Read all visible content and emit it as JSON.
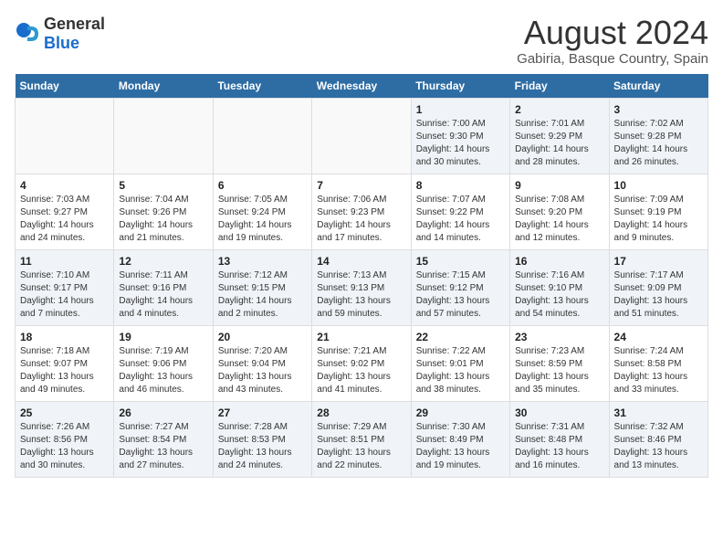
{
  "logo": {
    "general": "General",
    "blue": "Blue"
  },
  "title": "August 2024",
  "subtitle": "Gabiria, Basque Country, Spain",
  "days_of_week": [
    "Sunday",
    "Monday",
    "Tuesday",
    "Wednesday",
    "Thursday",
    "Friday",
    "Saturday"
  ],
  "weeks": [
    [
      {
        "day": "",
        "info": ""
      },
      {
        "day": "",
        "info": ""
      },
      {
        "day": "",
        "info": ""
      },
      {
        "day": "",
        "info": ""
      },
      {
        "day": "1",
        "info": "Sunrise: 7:00 AM\nSunset: 9:30 PM\nDaylight: 14 hours\nand 30 minutes."
      },
      {
        "day": "2",
        "info": "Sunrise: 7:01 AM\nSunset: 9:29 PM\nDaylight: 14 hours\nand 28 minutes."
      },
      {
        "day": "3",
        "info": "Sunrise: 7:02 AM\nSunset: 9:28 PM\nDaylight: 14 hours\nand 26 minutes."
      }
    ],
    [
      {
        "day": "4",
        "info": "Sunrise: 7:03 AM\nSunset: 9:27 PM\nDaylight: 14 hours\nand 24 minutes."
      },
      {
        "day": "5",
        "info": "Sunrise: 7:04 AM\nSunset: 9:26 PM\nDaylight: 14 hours\nand 21 minutes."
      },
      {
        "day": "6",
        "info": "Sunrise: 7:05 AM\nSunset: 9:24 PM\nDaylight: 14 hours\nand 19 minutes."
      },
      {
        "day": "7",
        "info": "Sunrise: 7:06 AM\nSunset: 9:23 PM\nDaylight: 14 hours\nand 17 minutes."
      },
      {
        "day": "8",
        "info": "Sunrise: 7:07 AM\nSunset: 9:22 PM\nDaylight: 14 hours\nand 14 minutes."
      },
      {
        "day": "9",
        "info": "Sunrise: 7:08 AM\nSunset: 9:20 PM\nDaylight: 14 hours\nand 12 minutes."
      },
      {
        "day": "10",
        "info": "Sunrise: 7:09 AM\nSunset: 9:19 PM\nDaylight: 14 hours\nand 9 minutes."
      }
    ],
    [
      {
        "day": "11",
        "info": "Sunrise: 7:10 AM\nSunset: 9:17 PM\nDaylight: 14 hours\nand 7 minutes."
      },
      {
        "day": "12",
        "info": "Sunrise: 7:11 AM\nSunset: 9:16 PM\nDaylight: 14 hours\nand 4 minutes."
      },
      {
        "day": "13",
        "info": "Sunrise: 7:12 AM\nSunset: 9:15 PM\nDaylight: 14 hours\nand 2 minutes."
      },
      {
        "day": "14",
        "info": "Sunrise: 7:13 AM\nSunset: 9:13 PM\nDaylight: 13 hours\nand 59 minutes."
      },
      {
        "day": "15",
        "info": "Sunrise: 7:15 AM\nSunset: 9:12 PM\nDaylight: 13 hours\nand 57 minutes."
      },
      {
        "day": "16",
        "info": "Sunrise: 7:16 AM\nSunset: 9:10 PM\nDaylight: 13 hours\nand 54 minutes."
      },
      {
        "day": "17",
        "info": "Sunrise: 7:17 AM\nSunset: 9:09 PM\nDaylight: 13 hours\nand 51 minutes."
      }
    ],
    [
      {
        "day": "18",
        "info": "Sunrise: 7:18 AM\nSunset: 9:07 PM\nDaylight: 13 hours\nand 49 minutes."
      },
      {
        "day": "19",
        "info": "Sunrise: 7:19 AM\nSunset: 9:06 PM\nDaylight: 13 hours\nand 46 minutes."
      },
      {
        "day": "20",
        "info": "Sunrise: 7:20 AM\nSunset: 9:04 PM\nDaylight: 13 hours\nand 43 minutes."
      },
      {
        "day": "21",
        "info": "Sunrise: 7:21 AM\nSunset: 9:02 PM\nDaylight: 13 hours\nand 41 minutes."
      },
      {
        "day": "22",
        "info": "Sunrise: 7:22 AM\nSunset: 9:01 PM\nDaylight: 13 hours\nand 38 minutes."
      },
      {
        "day": "23",
        "info": "Sunrise: 7:23 AM\nSunset: 8:59 PM\nDaylight: 13 hours\nand 35 minutes."
      },
      {
        "day": "24",
        "info": "Sunrise: 7:24 AM\nSunset: 8:58 PM\nDaylight: 13 hours\nand 33 minutes."
      }
    ],
    [
      {
        "day": "25",
        "info": "Sunrise: 7:26 AM\nSunset: 8:56 PM\nDaylight: 13 hours\nand 30 minutes."
      },
      {
        "day": "26",
        "info": "Sunrise: 7:27 AM\nSunset: 8:54 PM\nDaylight: 13 hours\nand 27 minutes."
      },
      {
        "day": "27",
        "info": "Sunrise: 7:28 AM\nSunset: 8:53 PM\nDaylight: 13 hours\nand 24 minutes."
      },
      {
        "day": "28",
        "info": "Sunrise: 7:29 AM\nSunset: 8:51 PM\nDaylight: 13 hours\nand 22 minutes."
      },
      {
        "day": "29",
        "info": "Sunrise: 7:30 AM\nSunset: 8:49 PM\nDaylight: 13 hours\nand 19 minutes."
      },
      {
        "day": "30",
        "info": "Sunrise: 7:31 AM\nSunset: 8:48 PM\nDaylight: 13 hours\nand 16 minutes."
      },
      {
        "day": "31",
        "info": "Sunrise: 7:32 AM\nSunset: 8:46 PM\nDaylight: 13 hours\nand 13 minutes."
      }
    ]
  ]
}
